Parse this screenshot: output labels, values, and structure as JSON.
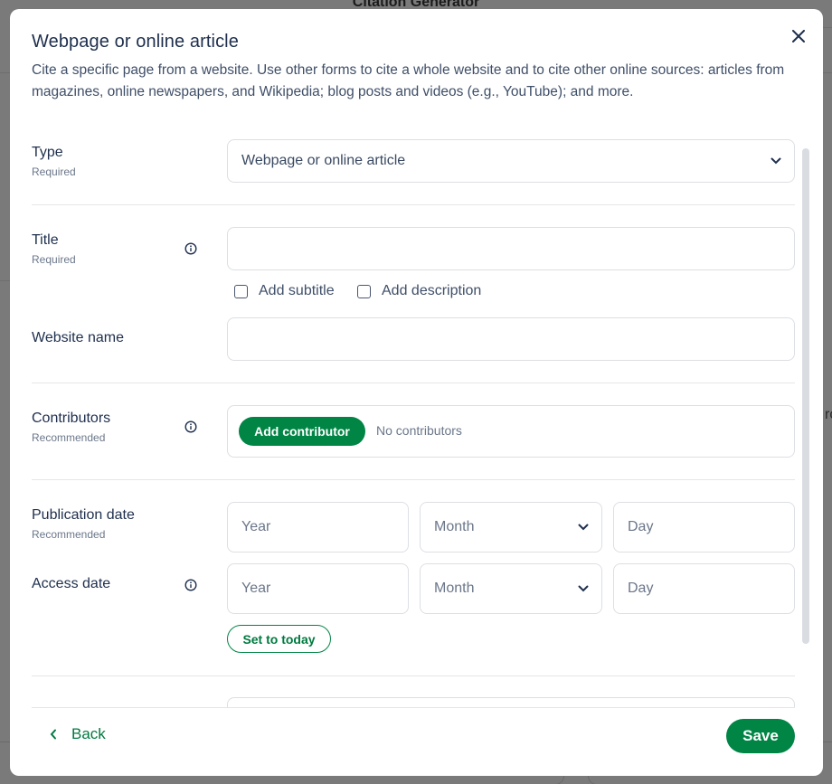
{
  "background": {
    "page_title": "Citation Generator",
    "edge_text": "ro"
  },
  "modal": {
    "title": "Webpage or online article",
    "description": "Cite a specific page from a website. Use other forms to cite a whole website and to cite other online sources: articles from magazines, online newspapers, and Wikipedia; blog posts and videos (e.g., YouTube); and more.",
    "close_icon": "close-icon"
  },
  "form": {
    "type": {
      "label": "Type",
      "sub": "Required",
      "selected": "Webpage or online article"
    },
    "title": {
      "label": "Title",
      "sub": "Required",
      "value": "",
      "add_subtitle": "Add subtitle",
      "add_description": "Add description"
    },
    "website_name": {
      "label": "Website name",
      "value": ""
    },
    "contributors": {
      "label": "Contributors",
      "sub": "Recommended",
      "add_button": "Add contributor",
      "empty_text": "No contributors"
    },
    "publication_date": {
      "label": "Publication date",
      "sub": "Recommended",
      "year_placeholder": "Year",
      "month_placeholder": "Month",
      "day_placeholder": "Day"
    },
    "access_date": {
      "label": "Access date",
      "year_placeholder": "Year",
      "month_placeholder": "Month",
      "day_placeholder": "Day",
      "set_today": "Set to today"
    }
  },
  "footer": {
    "back_label": "Back",
    "save_label": "Save"
  },
  "colors": {
    "accent": "#008545",
    "text_primary": "#1e2f4d",
    "overlay": "#7a7a7a"
  }
}
